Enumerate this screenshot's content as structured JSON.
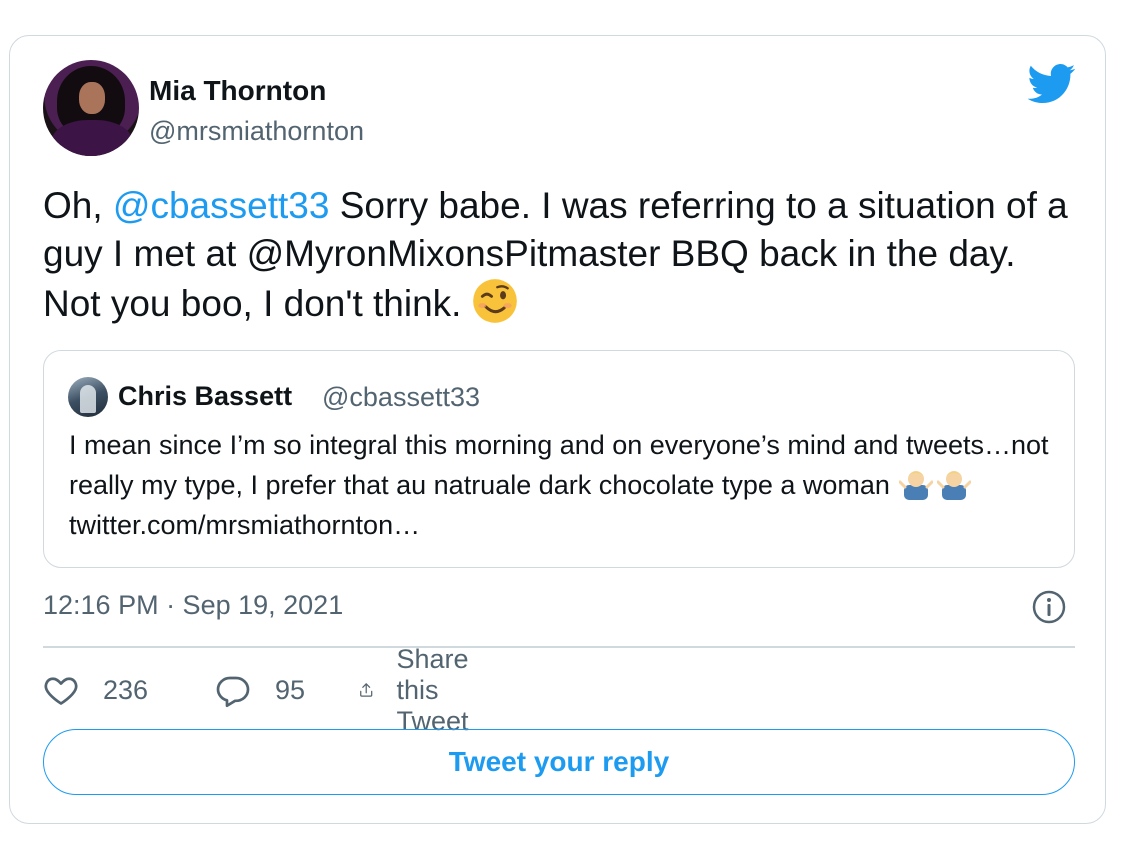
{
  "tweet": {
    "author_name": "Mia Thornton",
    "author_handle": "@mrsmiathornton",
    "text_part1": "Oh, ",
    "mention1": "@cbassett33",
    "text_part2": " Sorry babe.  I was referring to a situation of a guy I met at  ",
    "mention2": "@MyronMixonsPitmaster",
    "text_part3": " BBQ back in the day.  Not you boo,  I don't think. ",
    "emoji": "winking-face-emoji",
    "timestamp": "12:16 PM · Sep 19, 2021"
  },
  "quote": {
    "author_name": "Chris Bassett",
    "author_handle": "@cbassett33",
    "text_part1": "I mean since I’m so integral this morning and on everyone’s mind and tweets…not really my type, I prefer that au natruale dark chocolate type a woman ",
    "emoji": "man-shrugging-emoji",
    "text_part2": " twitter.com/mrsmiathornton…"
  },
  "actions": {
    "likes": "236",
    "replies": "95",
    "share_label": "Share this Tweet"
  },
  "reply_button_label": "Tweet your reply",
  "colors": {
    "accent": "#1d9bf0",
    "secondary_text": "#536471",
    "border": "#cfd9de"
  }
}
